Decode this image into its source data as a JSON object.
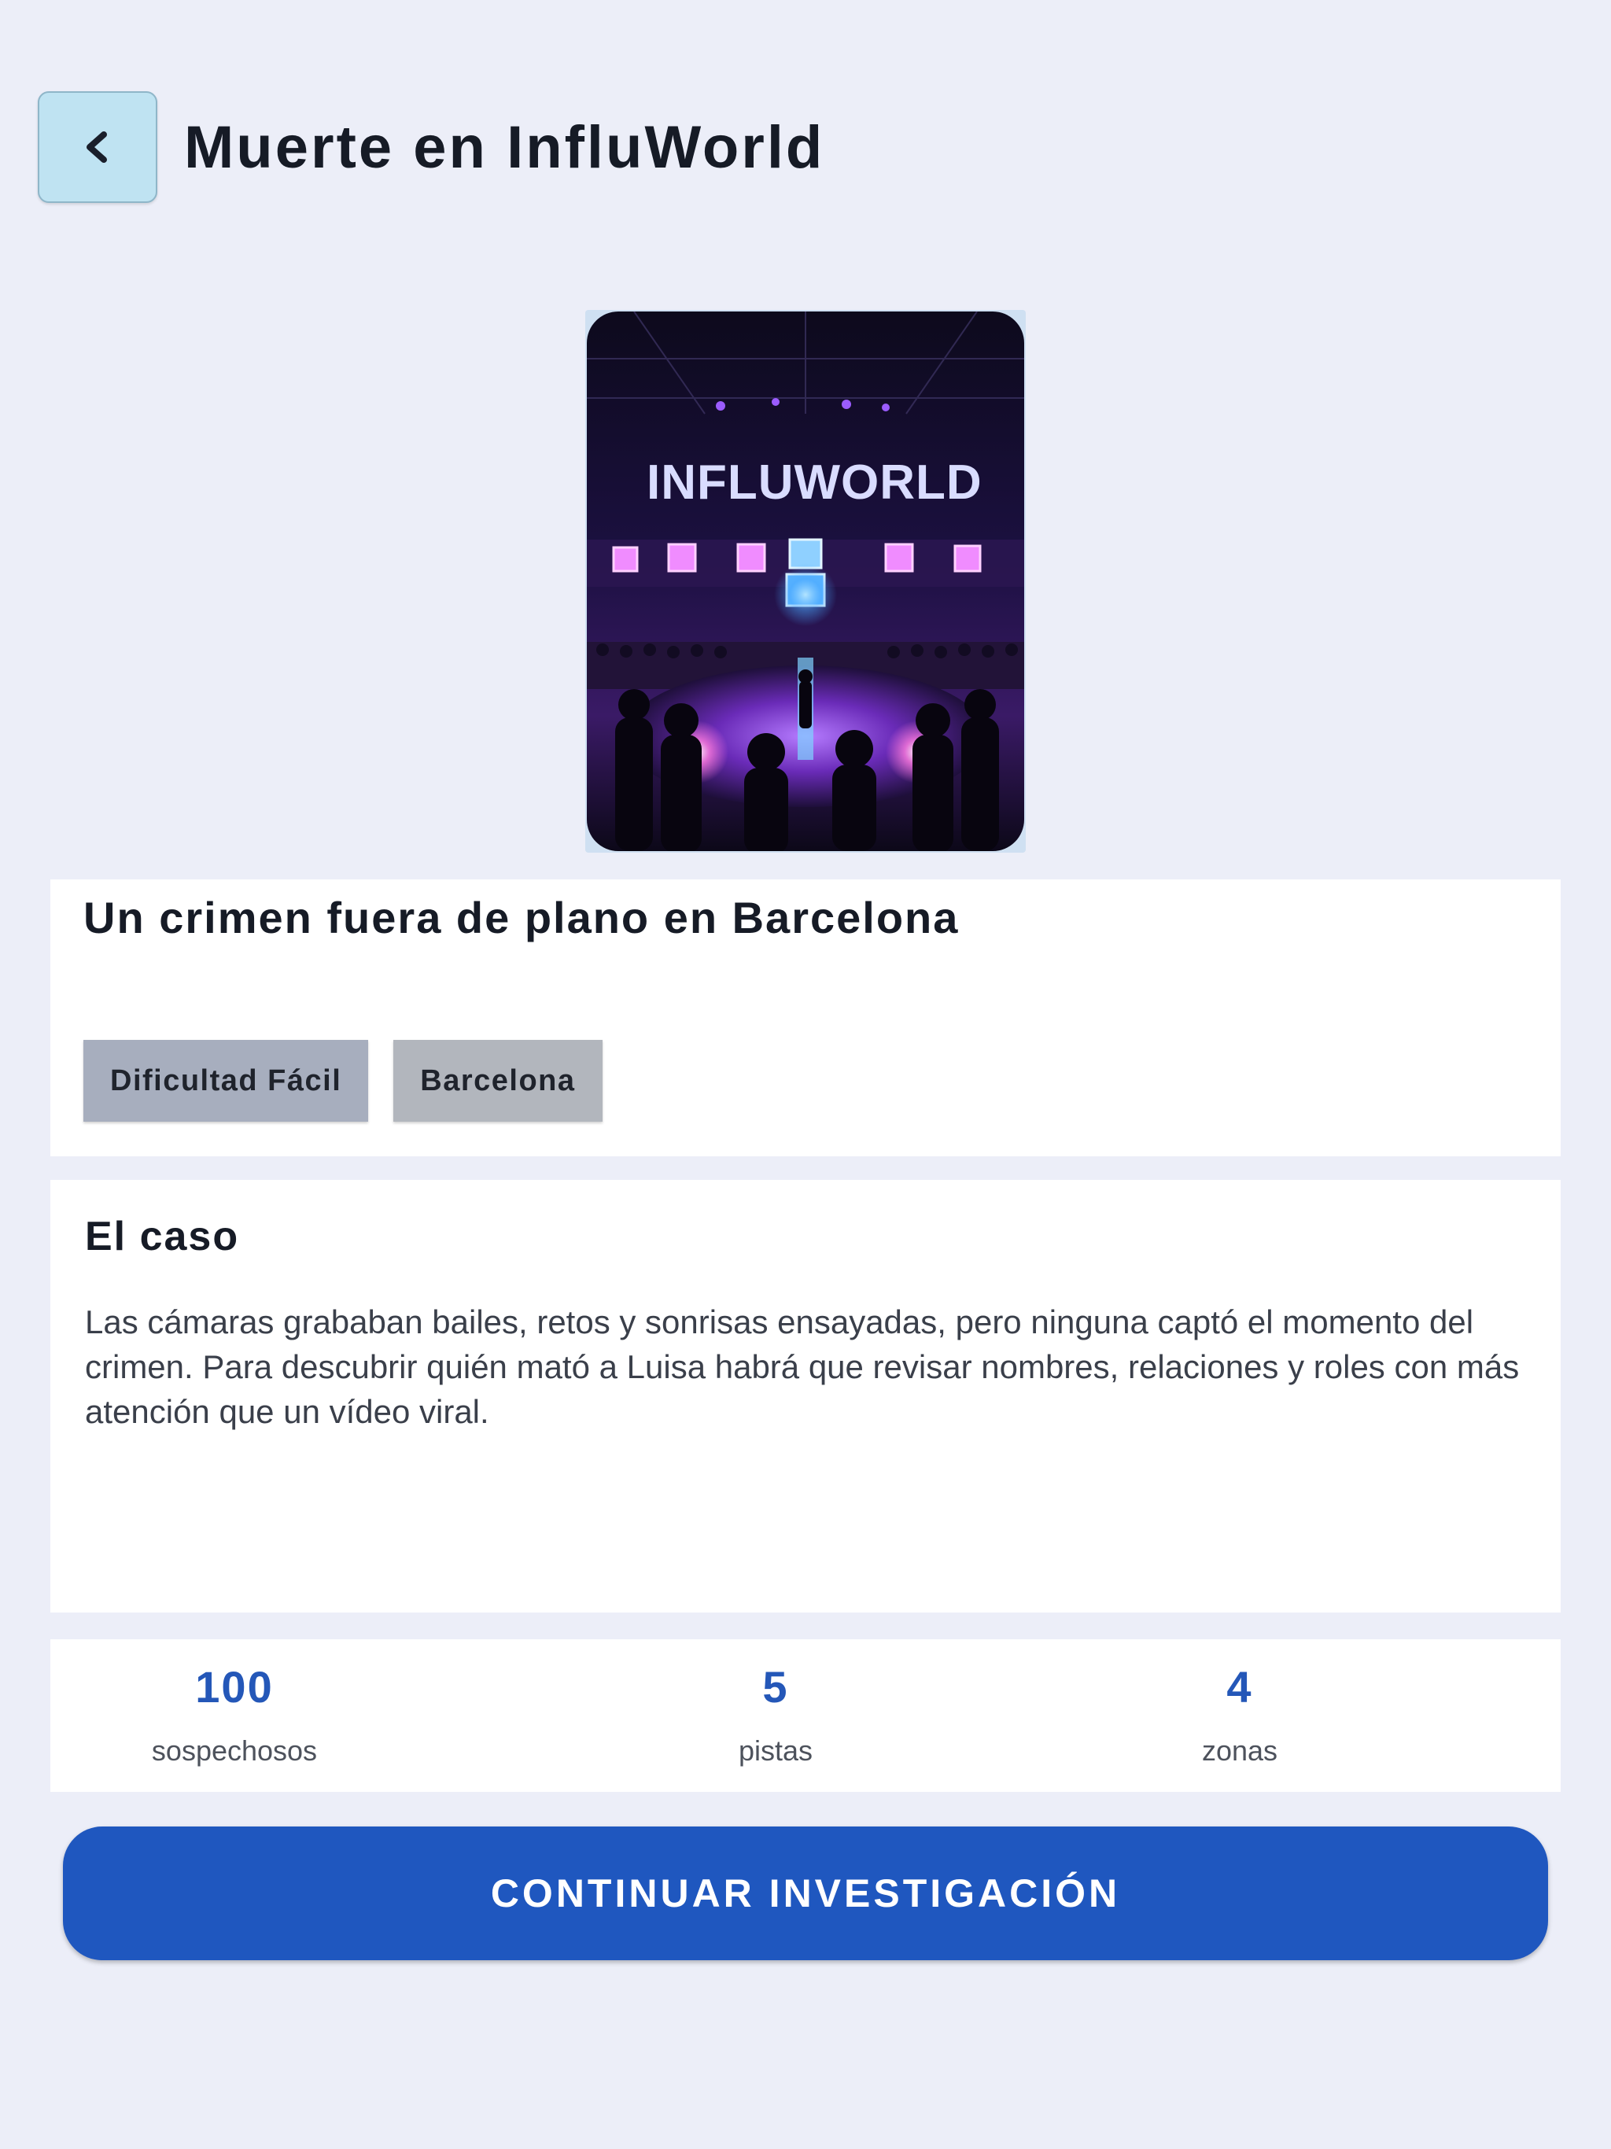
{
  "header": {
    "back_icon": "chevron-left-icon",
    "title": "Muerte en InfluWorld"
  },
  "cover": {
    "logo_text": "INFLUWORLD"
  },
  "hero": {
    "subtitle": "Un crimen fuera de plano en Barcelona",
    "chips": [
      "Dificultad Fácil",
      "Barcelona"
    ]
  },
  "case": {
    "title": "El caso",
    "description": "Las cámaras grababan bailes, retos y sonrisas ensayadas, pero ninguna captó el momento del crimen. Para descubrir quién mató a Luisa habrá que revisar nombres, relaciones y roles con más atención que un vídeo viral."
  },
  "stats": [
    {
      "value": "100",
      "label": "sospechosos"
    },
    {
      "value": "5",
      "label": "pistas"
    },
    {
      "value": "4",
      "label": "zonas"
    }
  ],
  "cta": {
    "label": "CONTINUAR INVESTIGACIÓN"
  },
  "colors": {
    "background": "#eceef8",
    "accent": "#1f57bf",
    "stat_number": "#2457b8",
    "back_button": "#bfe3f2"
  }
}
